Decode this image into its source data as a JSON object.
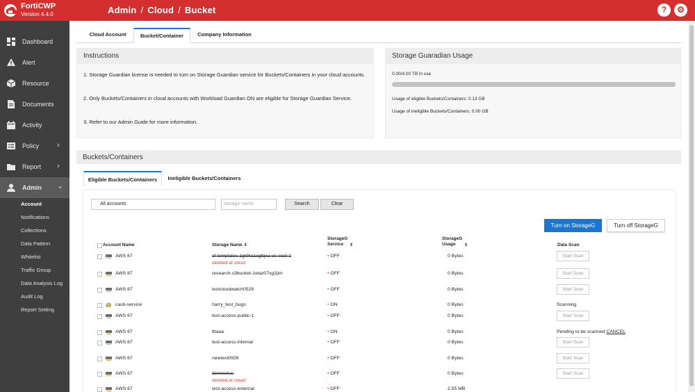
{
  "app": {
    "brand": "FortiCWP",
    "version": "Version 4.4.0"
  },
  "breadcrumb": [
    "Admin",
    "Cloud",
    "Bucket"
  ],
  "breadcrumb_sep": "/",
  "header_icons": {
    "help": "?",
    "settings": "⚙"
  },
  "sidebar": {
    "items": [
      {
        "label": "Dashboard",
        "icon": "dashboard-icon"
      },
      {
        "label": "Alert",
        "icon": "alert-icon"
      },
      {
        "label": "Resource",
        "icon": "resource-icon"
      },
      {
        "label": "Documents",
        "icon": "documents-icon"
      },
      {
        "label": "Activity",
        "icon": "activity-icon"
      },
      {
        "label": "Policy",
        "icon": "policy-icon",
        "chevron": "›"
      },
      {
        "label": "Report",
        "icon": "report-icon",
        "chevron": "›"
      },
      {
        "label": "Admin",
        "icon": "admin-icon",
        "chevron": "⌄"
      }
    ],
    "admin_sub": [
      "Account",
      "Notifications",
      "Collections",
      "Data Pattern",
      "Whitelist",
      "Traffic Group",
      "Data Analysis Log",
      "Audit Log",
      "Report Setting"
    ]
  },
  "tabs": [
    "Cloud Account",
    "Bucket/Container",
    "Company Information"
  ],
  "instructions": {
    "title": "Instructions",
    "lines": [
      "1. Storage Guardian license is needed to turn on Storage Guardian service for Buckets/Containers in your cloud accounts.",
      "2. Only Buckets/Containers in cloud accounts with Workload Guardian ON are eligible for Storage Guardian Service.",
      "3. Refer to our Admin Guide for more information."
    ]
  },
  "usage": {
    "title": "Storage Guaradian Usage",
    "summary": "0.00/4.00 TB in use",
    "fill_fraction": 0,
    "eligible": "Usage of eligible Buckets/Containers: 0.13 GB",
    "ineligible": "Usage of ineligible Buckets/Containers: 0.00 GB"
  },
  "buckets": {
    "title": "Buckets/Containers",
    "subtabs": [
      "Eligible Buckets/Containers",
      "Ineligible Buckets/Containers"
    ],
    "account_filter": "All accounts",
    "storage_placeholder": "storage name",
    "search_label": "Search",
    "clear_label": "Clear",
    "turn_on_label": "Turn on StorageG",
    "turn_off_label": "Turn off StorageG",
    "headers": {
      "account": "Account Name",
      "storage": "Storage Name",
      "service": "StorageG Service",
      "usage": "StorageG Usage",
      "scan": "Data Scan"
    },
    "sort_glyph": "⇕",
    "dot": "•",
    "start_scan_label": "Start Scan",
    "rows": [
      {
        "account": "AWS 67",
        "provider": "aws",
        "storage": "cf-templates-1gt0ka1cgfqxa-us-east-1",
        "deleted": true,
        "deleted_label": "deleted at cloud",
        "service": "OFF",
        "usage": "0 Bytes",
        "scan": "button"
      },
      {
        "account": "AWS 67",
        "provider": "aws",
        "storage": "research-s3bucket-1elaz07xg2jim",
        "deleted": false,
        "service": "OFF",
        "usage": "0 Bytes",
        "scan": "button"
      },
      {
        "account": "AWS 67",
        "provider": "aws",
        "storage": "testcloudwatch0529",
        "deleted": false,
        "service": "OFF",
        "usage": "0 Bytes",
        "scan": "button"
      },
      {
        "account": "casb-service",
        "provider": "gcp",
        "storage": "harry_test_bugs",
        "deleted": false,
        "service": "ON",
        "usage": "0 Bytes",
        "scan": "text",
        "scan_text": "Scanning"
      },
      {
        "account": "AWS 67",
        "provider": "aws",
        "storage": "test-access-public-1",
        "deleted": false,
        "service": "OFF",
        "usage": "0 Bytes",
        "scan": "button"
      },
      {
        "account": "AWS 67",
        "provider": "aws",
        "storage": "tttaaa",
        "deleted": false,
        "service": "ON",
        "usage": "0 Bytes",
        "scan": "pending",
        "scan_text": "Pending to be scanned",
        "cancel": "CANCEL"
      },
      {
        "account": "AWS 67",
        "provider": "aws",
        "storage": "test-access-internal",
        "deleted": false,
        "service": "OFF",
        "usage": "0 Bytes",
        "scan": "button"
      },
      {
        "account": "AWS 67",
        "provider": "aws",
        "storage": "newtest0926",
        "deleted": false,
        "service": "OFF",
        "usage": "0 Bytes",
        "scan": "button"
      },
      {
        "account": "AWS 67",
        "provider": "aws",
        "storage": "demovirus",
        "deleted": true,
        "deleted_label": "deleted at cloud",
        "service": "OFF",
        "usage": "0 Bytes",
        "scan": "button"
      },
      {
        "account": "AWS 67",
        "provider": "aws",
        "storage": "test-access-external",
        "deleted": false,
        "service": "OFF",
        "usage": "2.55 MB",
        "scan": "none"
      }
    ]
  },
  "colors": {
    "brand_red": "#d32f2f",
    "sidebar": "#3f3f3f",
    "accent_blue": "#1976d2",
    "off_red": "#e53935",
    "on_green": "#43a047"
  }
}
